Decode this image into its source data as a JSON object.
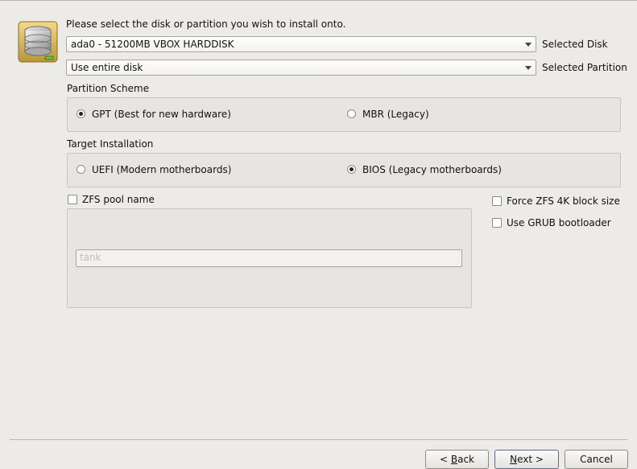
{
  "header": {
    "prompt": "Please select the disk or partition you wish to install onto."
  },
  "disk": {
    "value": "ada0 - 51200MB VBOX HARDDISK",
    "label": "Selected Disk"
  },
  "partition": {
    "value": "Use entire disk",
    "label": "Selected Partition"
  },
  "partition_scheme": {
    "title": "Partition Scheme",
    "options": [
      {
        "label": "GPT (Best for new hardware)",
        "selected": true
      },
      {
        "label": "MBR (Legacy)",
        "selected": false
      }
    ]
  },
  "target_installation": {
    "title": "Target Installation",
    "options": [
      {
        "label": "UEFI (Modern motherboards)",
        "selected": false
      },
      {
        "label": "BIOS (Legacy motherboards)",
        "selected": true
      }
    ]
  },
  "zfs": {
    "pool_name_label": "ZFS pool name",
    "pool_name_checked": false,
    "pool_name_placeholder": "tank",
    "force_4k_label": "Force ZFS 4K block size",
    "force_4k_checked": false,
    "grub_label": "Use GRUB bootloader",
    "grub_checked": false
  },
  "buttons": {
    "back_prefix": "< ",
    "back_mnemonic": "B",
    "back_rest": "ack",
    "next_mnemonic": "N",
    "next_rest": "ext >",
    "cancel": "Cancel"
  },
  "icons": {
    "disk": "hard-disk-icon",
    "dropdown": "chevron-down-icon"
  }
}
